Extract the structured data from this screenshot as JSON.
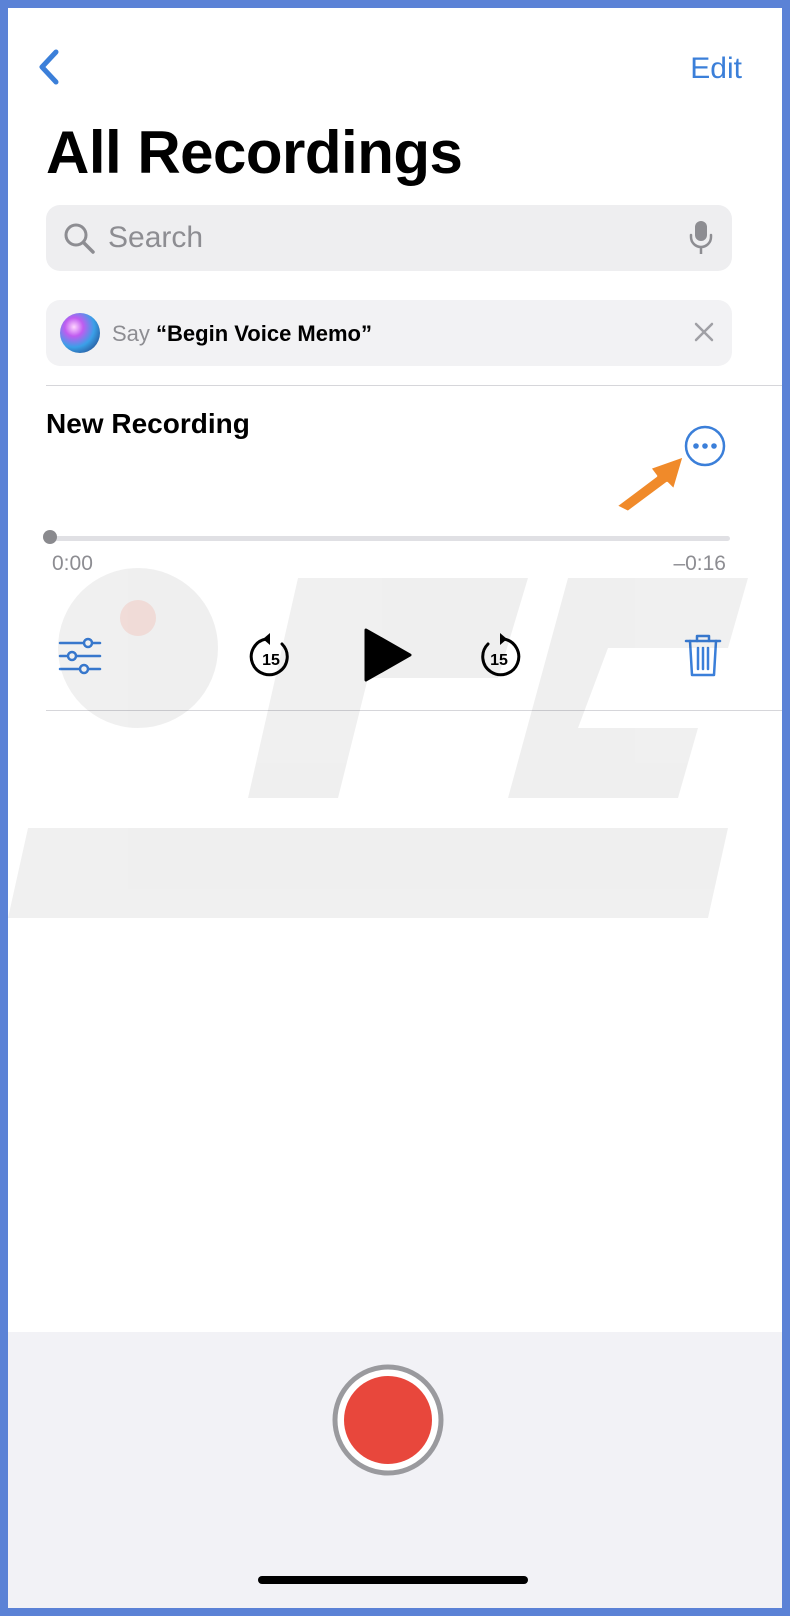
{
  "nav": {
    "edit_label": "Edit"
  },
  "header": {
    "title": "All Recordings"
  },
  "search": {
    "placeholder": "Search"
  },
  "siri_suggestion": {
    "prefix": "Say ",
    "phrase": "“Begin Voice Memo”"
  },
  "recording": {
    "name": "New Recording",
    "elapsed": "0:00",
    "remaining": "–0:16",
    "progress": 0.0,
    "skip_back_seconds": "15",
    "skip_forward_seconds": "15"
  },
  "icons": {
    "back": "chevron-left-icon",
    "search": "magnifier-icon",
    "mic": "microphone-icon",
    "siri": "siri-orb-icon",
    "close": "close-icon",
    "more": "ellipsis-circle-icon",
    "options": "sliders-icon",
    "skip_back": "skip-back-15-icon",
    "play": "play-icon",
    "skip_forward": "skip-forward-15-icon",
    "trash": "trash-icon",
    "record": "record-icon"
  },
  "colors": {
    "accent": "#3b7fd9",
    "record": "#e8473c",
    "callout_arrow": "#f08a2a"
  }
}
